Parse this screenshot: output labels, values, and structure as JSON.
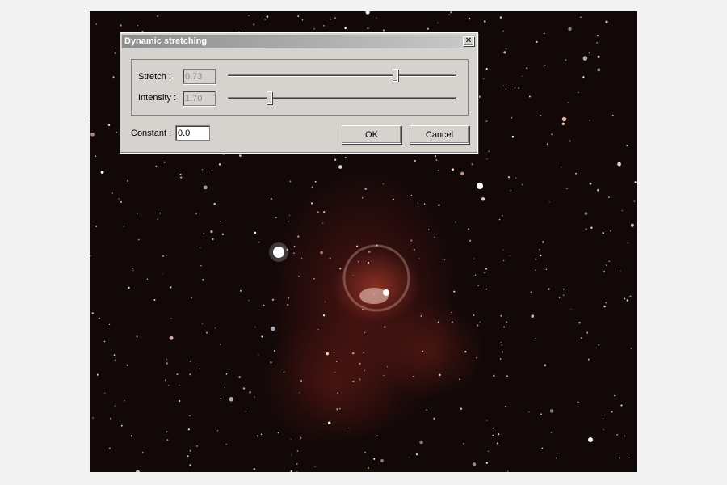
{
  "dialog": {
    "title": "Dynamic stretching",
    "close_glyph": "✕"
  },
  "stretch": {
    "label": "Stretch :",
    "value": "0.73",
    "slider_position": 0.73
  },
  "intensity": {
    "label": "Intensity :",
    "value": "1.70",
    "slider_position": 0.18
  },
  "constant": {
    "label": "Constant :",
    "value": "0.0"
  },
  "buttons": {
    "ok_label": "OK",
    "cancel_label": "Cancel"
  },
  "colors": {
    "dialog_face": "#d6d3ce",
    "title_gradient_start": "#8d8d8d",
    "title_gradient_end": "#c9c9c9",
    "sky_background": "#120808",
    "nebula": "#b4463a"
  },
  "icons": {
    "close": "close-icon"
  }
}
